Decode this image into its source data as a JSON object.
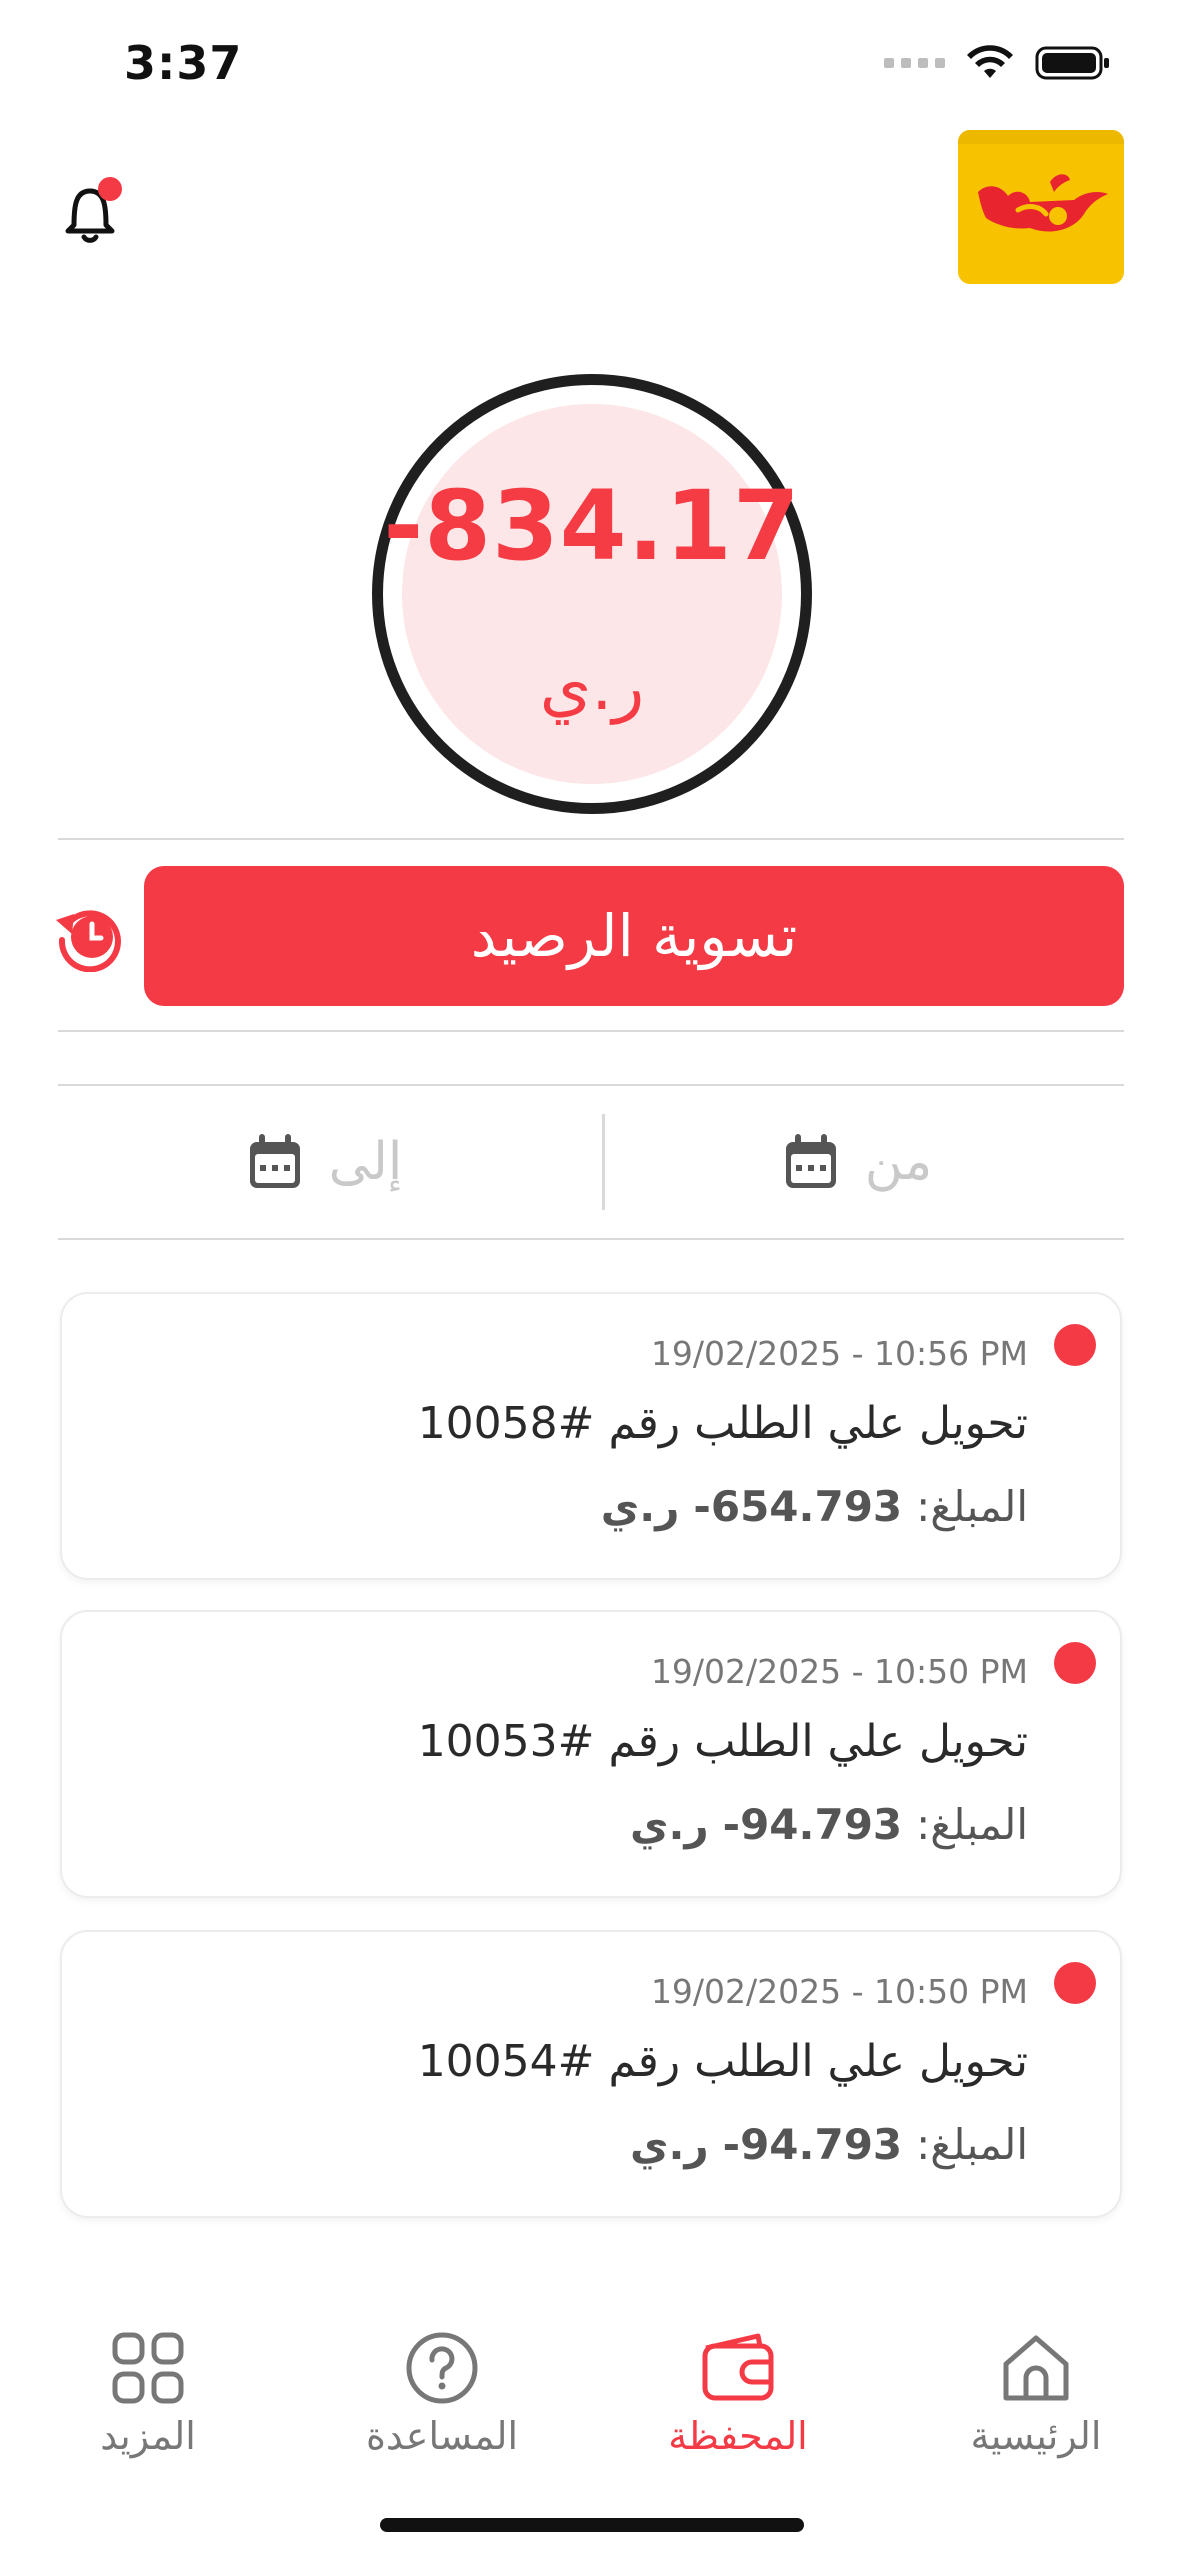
{
  "status_bar": {
    "time": "3:37"
  },
  "balance": {
    "amount": "-834.17",
    "currency": "ر.ي"
  },
  "settle_button": {
    "label": "تسوية الرصيد"
  },
  "date_filter": {
    "from_label": "من",
    "to_label": "إلى"
  },
  "transactions": [
    {
      "datetime": "19/02/2025 - 10:56 PM",
      "title": "تحويل علي الطلب رقم #10058",
      "amount_label": "المبلغ:",
      "amount_value": "-654.793",
      "currency": "ر.ي"
    },
    {
      "datetime": "19/02/2025 - 10:50 PM",
      "title": "تحويل علي الطلب رقم #10053",
      "amount_label": "المبلغ:",
      "amount_value": "-94.793",
      "currency": "ر.ي"
    },
    {
      "datetime": "19/02/2025 - 10:50 PM",
      "title": "تحويل علي الطلب رقم #10054",
      "amount_label": "المبلغ:",
      "amount_value": "-94.793",
      "currency": "ر.ي"
    }
  ],
  "bottom_nav": {
    "home": {
      "label": "الرئيسية",
      "icon": "home-icon"
    },
    "wallet": {
      "label": "المحفظة",
      "icon": "wallet-icon",
      "active": true
    },
    "help": {
      "label": "المساعدة",
      "icon": "help-icon"
    },
    "more": {
      "label": "المزيد",
      "icon": "grid-icon"
    }
  },
  "colors": {
    "accent": "#f43a45",
    "logo_bg": "#f7c300",
    "balance_bg": "#fde6e7"
  }
}
